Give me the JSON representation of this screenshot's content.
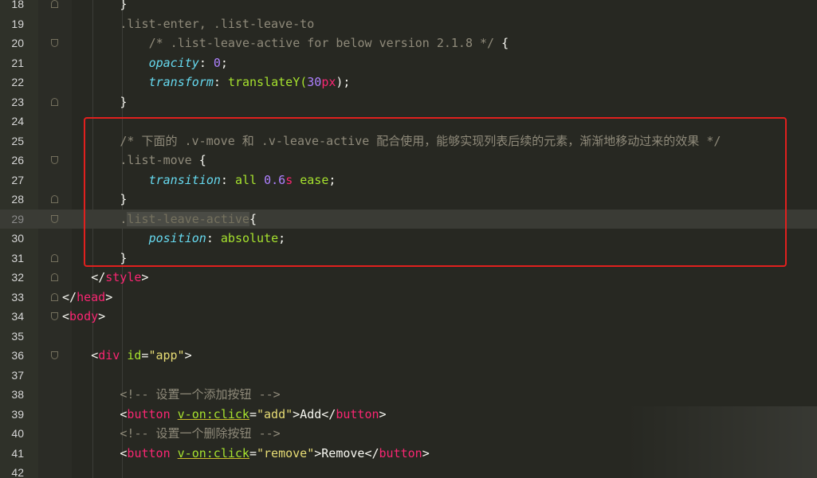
{
  "lines": [
    {
      "num": "18",
      "indent": 2,
      "fold": "close",
      "tokens": [
        {
          "t": "}",
          "c": "w"
        }
      ]
    },
    {
      "num": "19",
      "indent": 2,
      "fold": "",
      "tokens": [
        {
          "t": ".list-enter, .list-leave-to",
          "c": "c"
        }
      ]
    },
    {
      "num": "20",
      "indent": 3,
      "fold": "open",
      "tokens": [
        {
          "t": "/* .list-leave-active for below version 2.1.8 */",
          "c": "c"
        },
        {
          "t": " {",
          "c": "w"
        }
      ]
    },
    {
      "num": "21",
      "indent": 3,
      "fold": "",
      "tokens": [
        {
          "t": "opacity",
          "c": "prop"
        },
        {
          "t": ": ",
          "c": "w"
        },
        {
          "t": "0",
          "c": "num"
        },
        {
          "t": ";",
          "c": "w"
        }
      ]
    },
    {
      "num": "22",
      "indent": 3,
      "fold": "",
      "tokens": [
        {
          "t": "transform",
          "c": "prop"
        },
        {
          "t": ": ",
          "c": "w"
        },
        {
          "t": "translateY(",
          "c": "kw"
        },
        {
          "t": "30",
          "c": "num"
        },
        {
          "t": "px",
          "c": "unit"
        },
        {
          "t": ");",
          "c": "w"
        }
      ]
    },
    {
      "num": "23",
      "indent": 2,
      "fold": "close",
      "tokens": [
        {
          "t": "}",
          "c": "w"
        }
      ]
    },
    {
      "num": "24",
      "indent": 0,
      "fold": "",
      "tokens": []
    },
    {
      "num": "25",
      "indent": 2,
      "fold": "",
      "tokens": [
        {
          "t": "/* 下面的 .v-move 和 .v-leave-active 配合使用，能够实现列表后续的元素，渐渐地移动过来的效果 */",
          "c": "c"
        }
      ]
    },
    {
      "num": "26",
      "indent": 2,
      "fold": "open",
      "tokens": [
        {
          "t": ".list-move",
          "c": "c"
        },
        {
          "t": " {",
          "c": "w"
        }
      ]
    },
    {
      "num": "27",
      "indent": 3,
      "fold": "",
      "tokens": [
        {
          "t": "transition",
          "c": "prop"
        },
        {
          "t": ": ",
          "c": "w"
        },
        {
          "t": "all ",
          "c": "kw"
        },
        {
          "t": "0.6",
          "c": "num"
        },
        {
          "t": "s",
          "c": "unit"
        },
        {
          "t": " ease",
          "c": "kw"
        },
        {
          "t": ";",
          "c": "w"
        }
      ]
    },
    {
      "num": "28",
      "indent": 2,
      "fold": "close",
      "tokens": [
        {
          "t": "}",
          "c": "w"
        }
      ]
    },
    {
      "num": "29",
      "indent": 2,
      "fold": "open",
      "active": true,
      "tokens": [
        {
          "t": ".",
          "c": "c"
        },
        {
          "t": "list-leave-active",
          "c": "hl"
        },
        {
          "t": "{",
          "c": "w"
        }
      ]
    },
    {
      "num": "30",
      "indent": 3,
      "fold": "",
      "tokens": [
        {
          "t": "position",
          "c": "prop"
        },
        {
          "t": ": ",
          "c": "w"
        },
        {
          "t": "absolute",
          "c": "kw"
        },
        {
          "t": ";",
          "c": "w"
        }
      ]
    },
    {
      "num": "31",
      "indent": 2,
      "fold": "close",
      "tokens": [
        {
          "t": "}",
          "c": "w"
        }
      ]
    },
    {
      "num": "32",
      "indent": 1,
      "fold": "close",
      "tokens": [
        {
          "t": "</",
          "c": "w"
        },
        {
          "t": "style",
          "c": "tag"
        },
        {
          "t": ">",
          "c": "w"
        }
      ]
    },
    {
      "num": "33",
      "indent": 0,
      "fold": "close",
      "tokens": [
        {
          "t": "</",
          "c": "w"
        },
        {
          "t": "head",
          "c": "tag"
        },
        {
          "t": ">",
          "c": "w"
        }
      ]
    },
    {
      "num": "34",
      "indent": 0,
      "fold": "open",
      "tokens": [
        {
          "t": "<",
          "c": "w"
        },
        {
          "t": "body",
          "c": "tag"
        },
        {
          "t": ">",
          "c": "w"
        }
      ]
    },
    {
      "num": "35",
      "indent": 0,
      "fold": "",
      "tokens": []
    },
    {
      "num": "36",
      "indent": 1,
      "fold": "open",
      "tokens": [
        {
          "t": "<",
          "c": "w"
        },
        {
          "t": "div",
          "c": "tag"
        },
        {
          "t": " ",
          "c": "w"
        },
        {
          "t": "id",
          "c": "attr"
        },
        {
          "t": "=",
          "c": "w"
        },
        {
          "t": "\"app\"",
          "c": "str"
        },
        {
          "t": ">",
          "c": "w"
        }
      ]
    },
    {
      "num": "37",
      "indent": 0,
      "fold": "",
      "tokens": []
    },
    {
      "num": "38",
      "indent": 2,
      "fold": "",
      "tokens": [
        {
          "t": "<!-- 设置一个添加按钮 -->",
          "c": "c"
        }
      ]
    },
    {
      "num": "39",
      "indent": 2,
      "fold": "",
      "tokens": [
        {
          "t": "<",
          "c": "w"
        },
        {
          "t": "button",
          "c": "tag"
        },
        {
          "t": " ",
          "c": "w"
        },
        {
          "t": "v-on:click",
          "c": "attr-u"
        },
        {
          "t": "=",
          "c": "w"
        },
        {
          "t": "\"add\"",
          "c": "str"
        },
        {
          "t": ">Add</",
          "c": "w"
        },
        {
          "t": "button",
          "c": "tag"
        },
        {
          "t": ">",
          "c": "w"
        }
      ]
    },
    {
      "num": "40",
      "indent": 2,
      "fold": "",
      "tokens": [
        {
          "t": "<!-- 设置一个删除按钮 -->",
          "c": "c"
        }
      ]
    },
    {
      "num": "41",
      "indent": 2,
      "fold": "",
      "tokens": [
        {
          "t": "<",
          "c": "w"
        },
        {
          "t": "button",
          "c": "tag"
        },
        {
          "t": " ",
          "c": "w"
        },
        {
          "t": "v-on:click",
          "c": "attr-u"
        },
        {
          "t": "=",
          "c": "w"
        },
        {
          "t": "\"remove\"",
          "c": "str"
        },
        {
          "t": ">Remove</",
          "c": "w"
        },
        {
          "t": "button",
          "c": "tag"
        },
        {
          "t": ">",
          "c": "w"
        }
      ]
    },
    {
      "num": "42",
      "indent": 0,
      "fold": "",
      "tokens": []
    }
  ],
  "colors": {
    "background": "#272822",
    "gutter": "#2f3129",
    "highlight_box": "#e0201e",
    "comment": "#8f8a7a",
    "property": "#66d9ef",
    "number": "#ae81ff",
    "tag": "#f92672",
    "string": "#e6db74"
  }
}
